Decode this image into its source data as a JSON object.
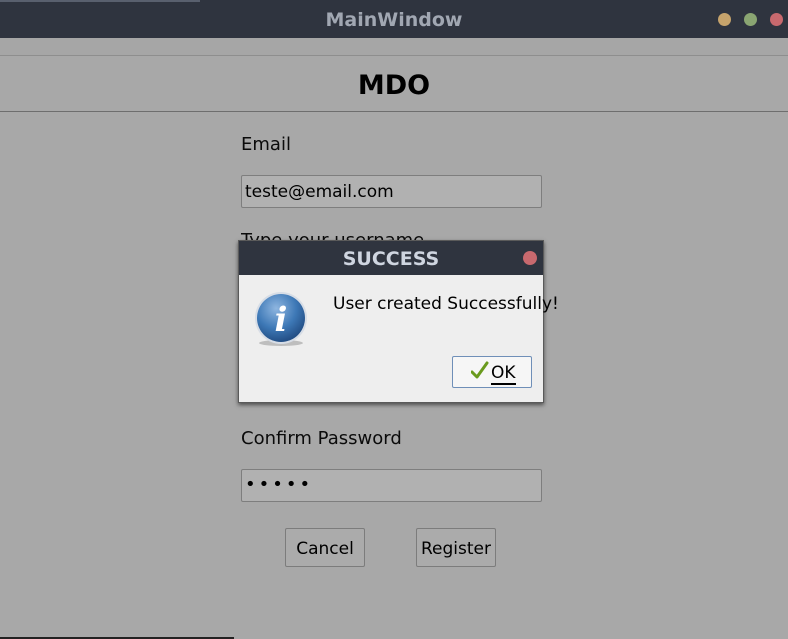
{
  "window": {
    "title": "MainWindow"
  },
  "header": {
    "title": "MDO"
  },
  "form": {
    "email_label": "Email",
    "email_value": "teste@email.com",
    "username_label": "Type your username",
    "confirm_password_label": "Confirm Password",
    "confirm_password_value": "•••••",
    "cancel_label": "Cancel",
    "register_label": "Register"
  },
  "dialog": {
    "title": "SUCCESS",
    "message": "User created Successfully!",
    "ok_label": "OK"
  },
  "colors": {
    "titlebar": "#2f343f",
    "window_bg": "#a8a8a8",
    "dialog_bg": "#eeeeee",
    "minimize": "#c6a36c",
    "maximize": "#8aa572",
    "close": "#c8696e",
    "info_blue": "#3d78b6"
  },
  "icons": {
    "dialog_icon": "info-icon",
    "ok_icon": "checkmark-icon"
  }
}
